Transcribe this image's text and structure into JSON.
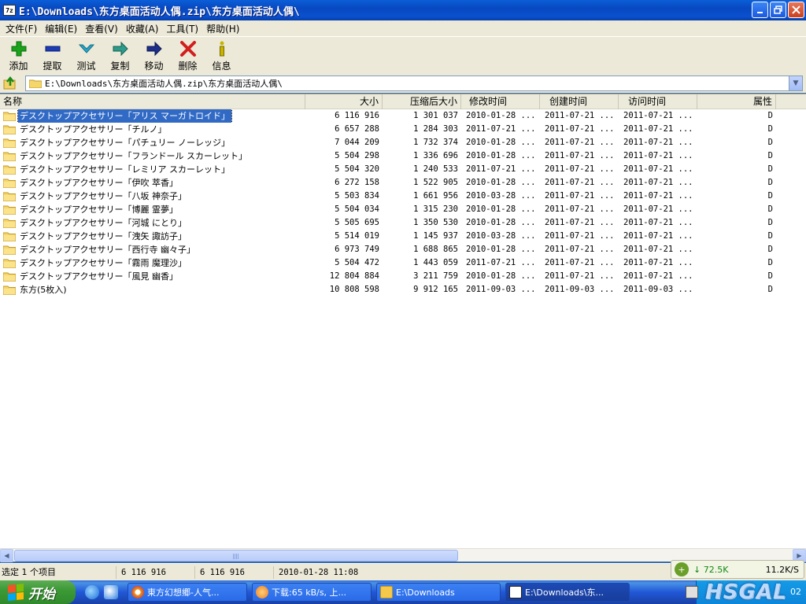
{
  "window": {
    "title": "E:\\Downloads\\东方桌面活动人偶.zip\\东方桌面活动人偶\\",
    "app_icon_label": "7z"
  },
  "menu": [
    {
      "label": "文件(F)"
    },
    {
      "label": "编辑(E)"
    },
    {
      "label": "查看(V)"
    },
    {
      "label": "收藏(A)"
    },
    {
      "label": "工具(T)"
    },
    {
      "label": "帮助(H)"
    }
  ],
  "toolbar": [
    {
      "label": "添加",
      "icon": "add-icon",
      "color": "#1aa31a"
    },
    {
      "label": "提取",
      "icon": "extract-icon",
      "color": "#1d3bb5"
    },
    {
      "label": "测试",
      "icon": "test-icon",
      "color": "#2aa6c8"
    },
    {
      "label": "复制",
      "icon": "copy-icon",
      "color": "#2d9b8a"
    },
    {
      "label": "移动",
      "icon": "move-icon",
      "color": "#1d2f8a"
    },
    {
      "label": "删除",
      "icon": "delete-icon",
      "color": "#d11e1e"
    },
    {
      "label": "信息",
      "icon": "info-icon",
      "color": "#c8b400"
    }
  ],
  "address": {
    "path": "E:\\Downloads\\东方桌面活动人偶.zip\\东方桌面活动人偶\\"
  },
  "columns": [
    {
      "label": "名称"
    },
    {
      "label": "大小"
    },
    {
      "label": "压缩后大小"
    },
    {
      "label": "修改时间"
    },
    {
      "label": "创建时间"
    },
    {
      "label": "访问时间"
    },
    {
      "label": "属性"
    }
  ],
  "rows": [
    {
      "name": "デスクトップアクセサリー「アリス マーガトロイド」",
      "size": "6 116 916",
      "packed": "1 301 037",
      "modified": "2010-01-28 ...",
      "created": "2011-07-21 ...",
      "accessed": "2011-07-21 ...",
      "attr": "D"
    },
    {
      "name": "デスクトップアクセサリー「チルノ」",
      "size": "6 657 288",
      "packed": "1 284 303",
      "modified": "2011-07-21 ...",
      "created": "2011-07-21 ...",
      "accessed": "2011-07-21 ...",
      "attr": "D"
    },
    {
      "name": "デスクトップアクセサリー「パチュリー ノーレッジ」",
      "size": "7 044 209",
      "packed": "1 732 374",
      "modified": "2010-01-28 ...",
      "created": "2011-07-21 ...",
      "accessed": "2011-07-21 ...",
      "attr": "D"
    },
    {
      "name": "デスクトップアクセサリー「フランドール スカーレット」",
      "size": "5 504 298",
      "packed": "1 336 696",
      "modified": "2010-01-28 ...",
      "created": "2011-07-21 ...",
      "accessed": "2011-07-21 ...",
      "attr": "D"
    },
    {
      "name": "デスクトップアクセサリー「レミリア スカーレット」",
      "size": "5 504 320",
      "packed": "1 240 533",
      "modified": "2011-07-21 ...",
      "created": "2011-07-21 ...",
      "accessed": "2011-07-21 ...",
      "attr": "D"
    },
    {
      "name": "デスクトップアクセサリー「伊吹 萃香」",
      "size": "6 272 158",
      "packed": "1 522 905",
      "modified": "2010-01-28 ...",
      "created": "2011-07-21 ...",
      "accessed": "2011-07-21 ...",
      "attr": "D"
    },
    {
      "name": "デスクトップアクセサリー「八坂 神奈子」",
      "size": "5 503 834",
      "packed": "1 661 956",
      "modified": "2010-03-28 ...",
      "created": "2011-07-21 ...",
      "accessed": "2011-07-21 ...",
      "attr": "D"
    },
    {
      "name": "デスクトップアクセサリー「博麗 霊夢」",
      "size": "5 504 034",
      "packed": "1 315 230",
      "modified": "2010-01-28 ...",
      "created": "2011-07-21 ...",
      "accessed": "2011-07-21 ...",
      "attr": "D"
    },
    {
      "name": "デスクトップアクセサリー「河城 にとり」",
      "size": "5 505 695",
      "packed": "1 350 530",
      "modified": "2010-01-28 ...",
      "created": "2011-07-21 ...",
      "accessed": "2011-07-21 ...",
      "attr": "D"
    },
    {
      "name": "デスクトップアクセサリー「洩矢 諏訪子」",
      "size": "5 514 019",
      "packed": "1 145 937",
      "modified": "2010-03-28 ...",
      "created": "2011-07-21 ...",
      "accessed": "2011-07-21 ...",
      "attr": "D"
    },
    {
      "name": "デスクトップアクセサリー「西行寺 幽々子」",
      "size": "6 973 749",
      "packed": "1 688 865",
      "modified": "2010-01-28 ...",
      "created": "2011-07-21 ...",
      "accessed": "2011-07-21 ...",
      "attr": "D"
    },
    {
      "name": "デスクトップアクセサリー「霧雨 魔理沙」",
      "size": "5 504 472",
      "packed": "1 443 059",
      "modified": "2011-07-21 ...",
      "created": "2011-07-21 ...",
      "accessed": "2011-07-21 ...",
      "attr": "D"
    },
    {
      "name": "デスクトップアクセサリー「風見 幽香」",
      "size": "12 804 884",
      "packed": "3 211 759",
      "modified": "2010-01-28 ...",
      "created": "2011-07-21 ...",
      "accessed": "2011-07-21 ...",
      "attr": "D"
    },
    {
      "name": "东方(5枚入)",
      "size": "10 808 598",
      "packed": "9 912 165",
      "modified": "2011-09-03 ...",
      "created": "2011-09-03 ...",
      "accessed": "2011-09-03 ...",
      "attr": "D"
    }
  ],
  "selected_row": 0,
  "status": {
    "selection": "选定 1 个项目",
    "size": "6 116 916",
    "packed": "6 116 916",
    "modified": "2010-01-28 11:08"
  },
  "net_widget": {
    "down": "↓ 72.5K",
    "up": "11.2K/S"
  },
  "taskbar": {
    "start_label": "开始",
    "tasks": [
      {
        "label": "東方幻想郷-人气...",
        "icon_color": "#e8a22a"
      },
      {
        "label": "下载:65 kB/s, 上...",
        "icon_color": "#f07a1e"
      },
      {
        "label": "E:\\Downloads",
        "icon_color": "#f3c84b"
      },
      {
        "label": "E:\\Downloads\\东...",
        "icon_color": "#ffffff"
      }
    ],
    "clock": "02",
    "watermark": "HSGAL"
  }
}
